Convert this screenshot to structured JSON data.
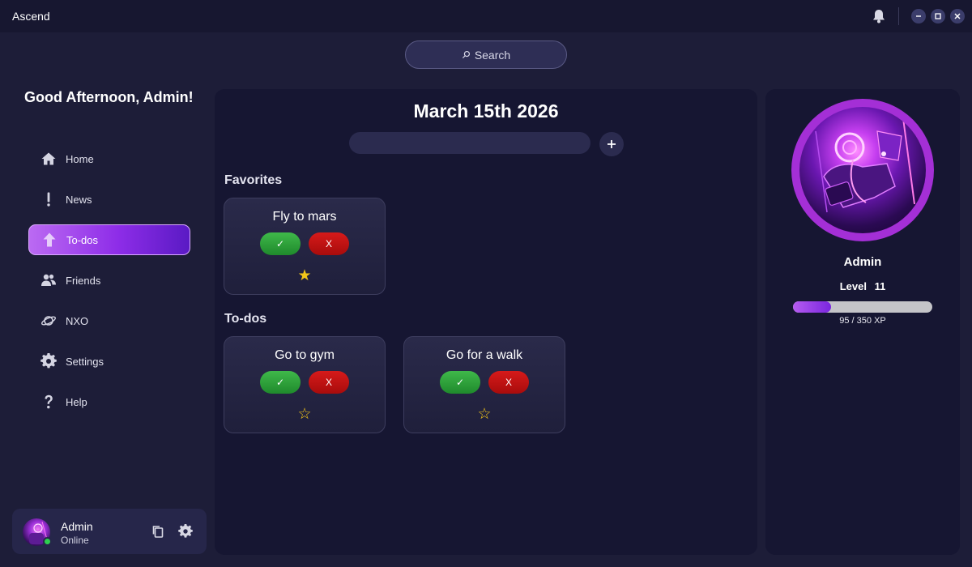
{
  "app": {
    "title": "Ascend"
  },
  "search": {
    "label": "Search"
  },
  "sidebar": {
    "greeting": "Good Afternoon, Admin!",
    "items": [
      {
        "label": "Home",
        "icon": "home-icon"
      },
      {
        "label": "News",
        "icon": "exclamation-icon"
      },
      {
        "label": "To-dos",
        "icon": "arrow-up-icon",
        "active": true
      },
      {
        "label": "Friends",
        "icon": "friends-icon"
      },
      {
        "label": "NXO",
        "icon": "planet-icon"
      },
      {
        "label": "Settings",
        "icon": "gear-icon"
      },
      {
        "label": "Help",
        "icon": "question-icon"
      }
    ],
    "user": {
      "name": "Admin",
      "status": "Online"
    }
  },
  "main": {
    "date": "March 15th 2026",
    "todo_input": {
      "value": ""
    },
    "favorites": {
      "title": "Favorites",
      "items": [
        {
          "title": "Fly to mars",
          "done_label": "✓",
          "delete_label": "X",
          "star": "★",
          "favorite": true
        }
      ]
    },
    "todos": {
      "title": "To-dos",
      "items": [
        {
          "title": "Go to gym",
          "done_label": "✓",
          "delete_label": "X",
          "star": "☆",
          "favorite": false
        },
        {
          "title": "Go for a walk",
          "done_label": "✓",
          "delete_label": "X",
          "star": "☆",
          "favorite": false
        }
      ]
    }
  },
  "profile": {
    "name": "Admin",
    "level_label": "Level",
    "level": "11",
    "xp_text": "95 / 350 XP",
    "xp_current": 95,
    "xp_max": 350
  },
  "colors": {
    "accent": "#8e2de8",
    "done": "#2e9e3a",
    "delete": "#c41111",
    "star": "#f2c619",
    "online": "#2ecf4f"
  }
}
